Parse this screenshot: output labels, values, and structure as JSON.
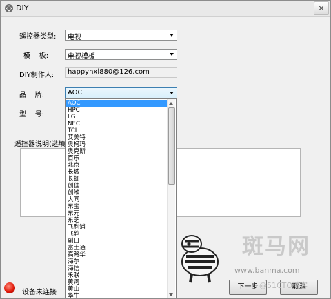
{
  "window": {
    "title": "DIY",
    "close_label": "×"
  },
  "form": {
    "remote_type_label": "遥控器类型:",
    "remote_type_value": "电视",
    "template_label": "模    板:",
    "template_value": "电视模板",
    "maker_label": "DIY制作人:",
    "maker_value": "happyhxl880@126.com",
    "brand_label": "品    牌:",
    "brand_value": "AOC",
    "model_label": "型    号:",
    "description_label": "遥控器说明(选填)"
  },
  "brand_options": [
    "AOC",
    "HPC",
    "LG",
    "NEC",
    "TCL",
    "艾美特",
    "奥柯玛",
    "奥克斯",
    "百乐",
    "北京",
    "长城",
    "长虹",
    "创佳",
    "创维",
    "大同",
    "东宝",
    "东元",
    "东芝",
    "飞利浦",
    "飞鹤",
    "副日",
    "富士通",
    "高路华",
    "海尔",
    "海信",
    "禾联",
    "黄河",
    "黄山",
    "华生"
  ],
  "status": {
    "text": "设备未连接"
  },
  "buttons": {
    "next": "下一步",
    "cancel": "取消"
  },
  "watermark": {
    "brand": "斑马网",
    "url": "www.banma.com",
    "blog": "@51CTO博客"
  },
  "colors": {
    "selection": "#3399ff",
    "status_dot": "#e11a0a"
  }
}
